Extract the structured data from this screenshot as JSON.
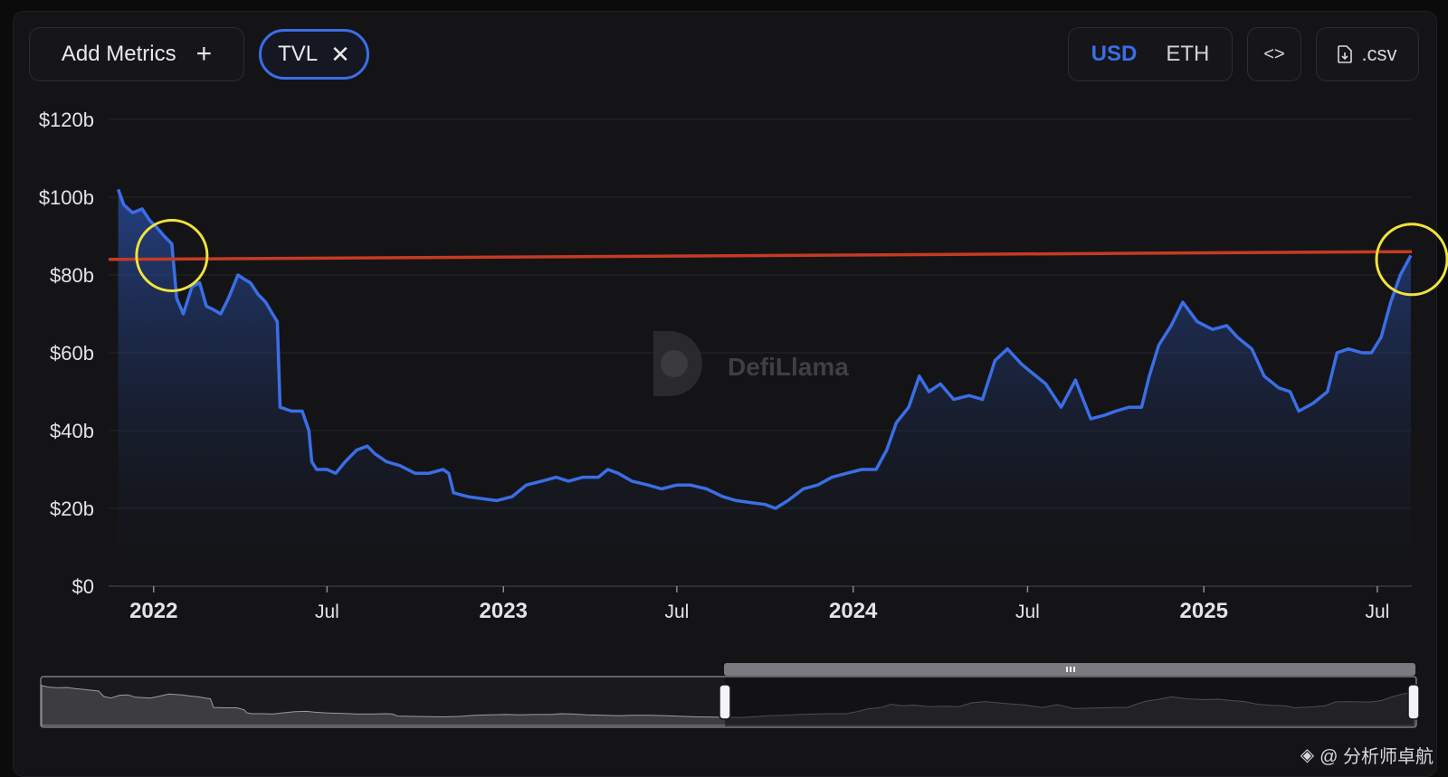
{
  "toolbar": {
    "add_metrics_label": "Add Metrics",
    "add_icon": "plus-icon",
    "metric_chip_label": "TVL",
    "remove_icon": "close-icon",
    "currency_active": "USD",
    "currency_inactive": "ETH",
    "embed_icon": "code-icon",
    "csv_label": ".csv",
    "csv_icon": "file-download-icon"
  },
  "watermark": "DefiLlama",
  "footer_credit": "@ 分析师卓航",
  "colors": {
    "line": "#3b6ee6",
    "reference_line": "#c63a22",
    "highlight_circle": "#f1e33a",
    "grid": "#26262b"
  },
  "chart_data": {
    "type": "area",
    "title": "",
    "xlabel": "",
    "ylabel": "",
    "ylim": [
      0,
      120
    ],
    "y_unit": "b",
    "y_ticks": [
      "$0",
      "$20b",
      "$40b",
      "$60b",
      "$80b",
      "$100b",
      "$120b"
    ],
    "x_range": [
      "2021-11-15",
      "2025-08-06"
    ],
    "x_ticks": [
      {
        "date": "2022-01-01",
        "label": "2022",
        "bold": true
      },
      {
        "date": "2022-07-01",
        "label": "Jul",
        "bold": false
      },
      {
        "date": "2023-01-01",
        "label": "2023",
        "bold": true
      },
      {
        "date": "2023-07-01",
        "label": "Jul",
        "bold": false
      },
      {
        "date": "2024-01-01",
        "label": "2024",
        "bold": true
      },
      {
        "date": "2024-07-01",
        "label": "Jul",
        "bold": false
      },
      {
        "date": "2025-01-01",
        "label": "2025",
        "bold": true
      },
      {
        "date": "2025-07-01",
        "label": "Jul",
        "bold": false
      }
    ],
    "grid": true,
    "series": [
      {
        "name": "TVL",
        "points": [
          [
            "2021-11-25",
            102
          ],
          [
            "2021-12-01",
            98
          ],
          [
            "2021-12-10",
            96
          ],
          [
            "2021-12-20",
            97
          ],
          [
            "2021-12-28",
            94
          ],
          [
            "2022-01-05",
            92
          ],
          [
            "2022-01-12",
            90
          ],
          [
            "2022-01-20",
            88
          ],
          [
            "2022-01-25",
            74
          ],
          [
            "2022-02-01",
            70
          ],
          [
            "2022-02-10",
            77
          ],
          [
            "2022-02-18",
            78
          ],
          [
            "2022-02-25",
            72
          ],
          [
            "2022-03-05",
            71
          ],
          [
            "2022-03-12",
            70
          ],
          [
            "2022-03-20",
            74
          ],
          [
            "2022-03-30",
            80
          ],
          [
            "2022-04-05",
            79
          ],
          [
            "2022-04-12",
            78
          ],
          [
            "2022-04-20",
            75
          ],
          [
            "2022-04-28",
            73
          ],
          [
            "2022-05-05",
            70
          ],
          [
            "2022-05-10",
            68
          ],
          [
            "2022-05-13",
            46
          ],
          [
            "2022-05-25",
            45
          ],
          [
            "2022-06-05",
            45
          ],
          [
            "2022-06-12",
            40
          ],
          [
            "2022-06-15",
            32
          ],
          [
            "2022-06-20",
            30
          ],
          [
            "2022-07-01",
            30
          ],
          [
            "2022-07-10",
            29
          ],
          [
            "2022-07-20",
            32
          ],
          [
            "2022-08-01",
            35
          ],
          [
            "2022-08-12",
            36
          ],
          [
            "2022-08-20",
            34
          ],
          [
            "2022-09-01",
            32
          ],
          [
            "2022-09-15",
            31
          ],
          [
            "2022-10-01",
            29
          ],
          [
            "2022-10-15",
            29
          ],
          [
            "2022-10-30",
            30
          ],
          [
            "2022-11-05",
            29
          ],
          [
            "2022-11-10",
            24
          ],
          [
            "2022-11-25",
            23
          ],
          [
            "2022-12-10",
            22.5
          ],
          [
            "2022-12-25",
            22
          ],
          [
            "2023-01-10",
            23
          ],
          [
            "2023-01-25",
            26
          ],
          [
            "2023-02-10",
            27
          ],
          [
            "2023-02-25",
            28
          ],
          [
            "2023-03-10",
            27
          ],
          [
            "2023-03-25",
            28
          ],
          [
            "2023-04-10",
            28
          ],
          [
            "2023-04-20",
            30
          ],
          [
            "2023-05-01",
            29
          ],
          [
            "2023-05-15",
            27
          ],
          [
            "2023-06-01",
            26
          ],
          [
            "2023-06-15",
            25
          ],
          [
            "2023-07-01",
            26
          ],
          [
            "2023-07-15",
            26
          ],
          [
            "2023-08-01",
            25
          ],
          [
            "2023-08-18",
            23
          ],
          [
            "2023-09-01",
            22
          ],
          [
            "2023-09-15",
            21.5
          ],
          [
            "2023-10-01",
            21
          ],
          [
            "2023-10-12",
            20
          ],
          [
            "2023-10-25",
            22
          ],
          [
            "2023-11-10",
            25
          ],
          [
            "2023-11-25",
            26
          ],
          [
            "2023-12-10",
            28
          ],
          [
            "2023-12-25",
            29
          ],
          [
            "2024-01-10",
            30
          ],
          [
            "2024-01-25",
            30
          ],
          [
            "2024-02-05",
            35
          ],
          [
            "2024-02-15",
            42
          ],
          [
            "2024-02-28",
            46
          ],
          [
            "2024-03-10",
            54
          ],
          [
            "2024-03-20",
            50
          ],
          [
            "2024-04-01",
            52
          ],
          [
            "2024-04-15",
            48
          ],
          [
            "2024-05-01",
            49
          ],
          [
            "2024-05-15",
            48
          ],
          [
            "2024-05-28",
            58
          ],
          [
            "2024-06-10",
            61
          ],
          [
            "2024-06-25",
            57
          ],
          [
            "2024-07-05",
            55
          ],
          [
            "2024-07-20",
            52
          ],
          [
            "2024-08-05",
            46
          ],
          [
            "2024-08-20",
            53
          ],
          [
            "2024-09-05",
            43
          ],
          [
            "2024-09-20",
            44
          ],
          [
            "2024-10-01",
            45
          ],
          [
            "2024-10-15",
            46
          ],
          [
            "2024-10-28",
            46
          ],
          [
            "2024-11-05",
            54
          ],
          [
            "2024-11-15",
            62
          ],
          [
            "2024-11-28",
            67
          ],
          [
            "2024-12-10",
            73
          ],
          [
            "2024-12-25",
            68
          ],
          [
            "2025-01-10",
            66
          ],
          [
            "2025-01-25",
            67
          ],
          [
            "2025-02-05",
            64
          ],
          [
            "2025-02-20",
            61
          ],
          [
            "2025-03-05",
            54
          ],
          [
            "2025-03-20",
            51
          ],
          [
            "2025-04-01",
            50
          ],
          [
            "2025-04-10",
            45
          ],
          [
            "2025-04-25",
            47
          ],
          [
            "2025-05-10",
            50
          ],
          [
            "2025-05-20",
            60
          ],
          [
            "2025-06-01",
            61
          ],
          [
            "2025-06-15",
            60
          ],
          [
            "2025-06-25",
            60
          ],
          [
            "2025-07-05",
            64
          ],
          [
            "2025-07-15",
            73
          ],
          [
            "2025-07-25",
            80
          ],
          [
            "2025-08-05",
            85
          ]
        ]
      }
    ],
    "reference_line": {
      "from": [
        "2021-11-15",
        84
      ],
      "to": [
        "2025-08-06",
        86
      ]
    },
    "highlights": [
      {
        "date": "2022-01-20",
        "value": 85
      },
      {
        "date": "2025-08-06",
        "value": 84
      }
    ]
  }
}
